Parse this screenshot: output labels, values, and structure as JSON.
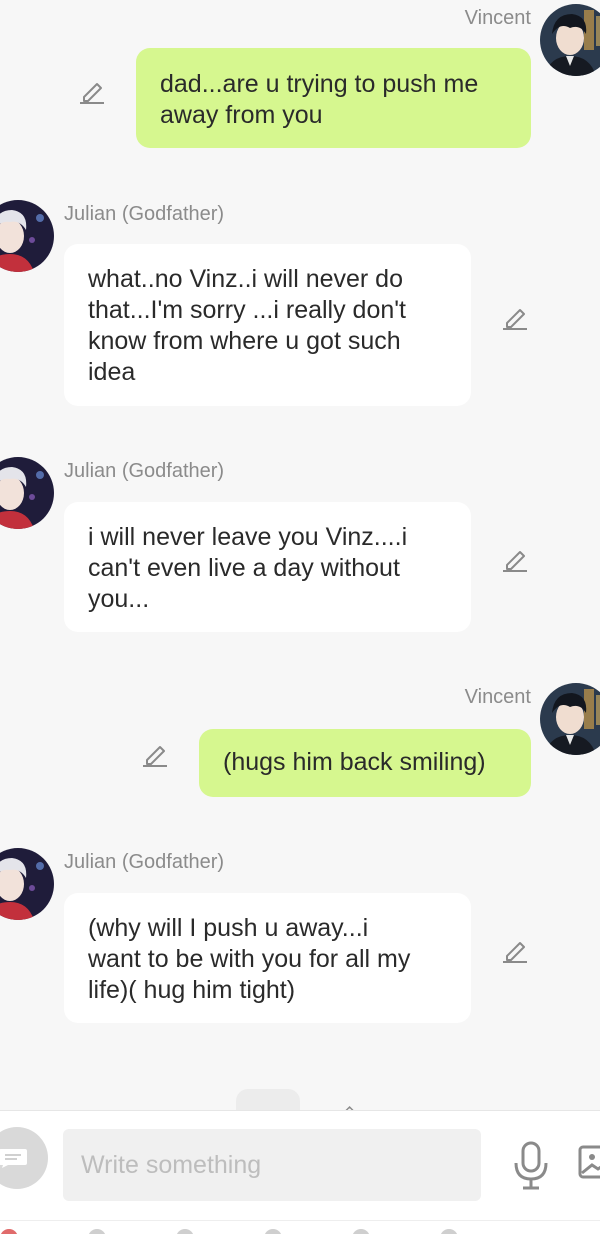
{
  "messages": [
    {
      "sender": "Vincent",
      "side": "me",
      "lines": [
        "dad...are u trying to push me",
        "away from you"
      ]
    },
    {
      "sender": "Julian (Godfather)",
      "side": "them",
      "lines": [
        "what..no Vinz..i will never do",
        "that...I'm sorry ...i really don't",
        "know from where u got such",
        "idea"
      ]
    },
    {
      "sender": "Julian (Godfather)",
      "side": "them",
      "lines": [
        "i will never leave you Vinz....i",
        "can't even live a day without",
        "you..."
      ]
    },
    {
      "sender": "Vincent",
      "side": "me",
      "lines": [
        "(hugs him back smiling)"
      ]
    },
    {
      "sender": "Julian (Godfather)",
      "side": "them",
      "lines": [
        "(why will I push u away...i",
        "want to be with you for all my",
        "life)( hug him tight)"
      ]
    }
  ],
  "composer": {
    "placeholder": "Write something"
  },
  "icons": {
    "edit": "pencil-icon",
    "menu": "chat-menu-icon",
    "mic": "microphone-icon",
    "image": "image-icon"
  },
  "colors": {
    "background": "#f7f7f7",
    "my_bubble": "#d6f78f",
    "their_bubble": "#ffffff",
    "name_text": "#8b8b8b",
    "icon_gray": "#8a8a8a"
  }
}
